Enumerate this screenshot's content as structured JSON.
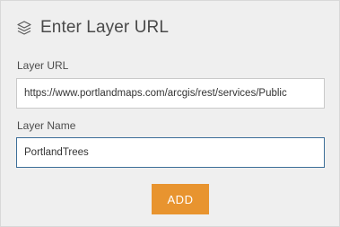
{
  "header": {
    "icon": "layers-icon",
    "title": "Enter Layer URL"
  },
  "form": {
    "url_label": "Layer URL",
    "url_value": "https://www.portlandmaps.com/arcgis/rest/services/Public",
    "name_label": "Layer Name",
    "name_value": "PortlandTrees"
  },
  "actions": {
    "add_label": "ADD"
  },
  "colors": {
    "background": "#efefef",
    "accent": "#e8942f",
    "focus_border": "#3c6e98"
  }
}
